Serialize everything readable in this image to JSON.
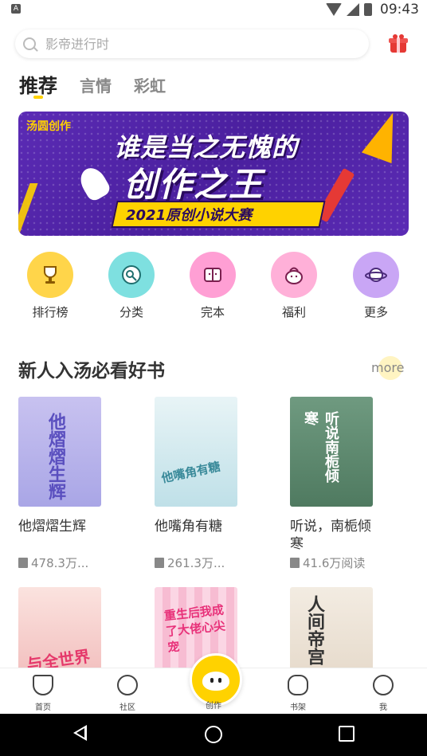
{
  "status_bar": {
    "time": "09:43",
    "app_icon_letter": "A"
  },
  "search": {
    "placeholder": "影帝进行时"
  },
  "tabs": [
    {
      "label": "推荐",
      "active": true
    },
    {
      "label": "言情",
      "active": false
    },
    {
      "label": "彩虹",
      "active": false
    }
  ],
  "banner": {
    "logo": "汤圆创作",
    "title_line1": "谁是当之无愧的",
    "title_line2": "创作之王",
    "subtitle": "2021原创小说大赛"
  },
  "categories": [
    {
      "label": "排行榜",
      "icon": "trophy-icon",
      "color": "#ffd54a"
    },
    {
      "label": "分类",
      "icon": "category-icon",
      "color": "#7ee0e0"
    },
    {
      "label": "完本",
      "icon": "book-open-icon",
      "color": "#ff9fd4"
    },
    {
      "label": "福利",
      "icon": "gift-bag-icon",
      "color": "#ffb0d8"
    },
    {
      "label": "更多",
      "icon": "planet-icon",
      "color": "#c9a6f5"
    }
  ],
  "section": {
    "title": "新人入汤必看好书",
    "more": "more"
  },
  "books": [
    {
      "title": "他熠熠生辉",
      "reads": "478.3万...",
      "cover_text": "他熠熠生辉",
      "cover_bg": "#b8b4e8"
    },
    {
      "title": "他嘴角有糖",
      "reads": "261.3万...",
      "cover_text": "他嘴角有糖",
      "cover_bg": "#cfe8ef"
    },
    {
      "title": "听说，南栀倾寒",
      "reads": "41.6万阅读",
      "cover_text": "听说南栀倾寒",
      "cover_bg": "#5f8b70"
    },
    {
      "title": "",
      "reads": "",
      "cover_text": "与全世界",
      "cover_bg": "#f6d0cf"
    },
    {
      "title": "",
      "reads": "",
      "cover_text": "重生后我成了大佬心尖宠",
      "cover_bg": "#f9c9dd"
    },
    {
      "title": "",
      "reads": "",
      "cover_text": "人间帝宫",
      "cover_bg": "#efe6d9"
    }
  ],
  "bottom_nav": [
    {
      "label": "首页",
      "icon": "home-icon"
    },
    {
      "label": "社区",
      "icon": "community-icon"
    },
    {
      "label": "创作",
      "icon": "create-icon"
    },
    {
      "label": "书架",
      "icon": "bookshelf-star-icon"
    },
    {
      "label": "我",
      "icon": "profile-icon"
    }
  ],
  "colors": {
    "accent": "#ffd200",
    "banner_bg": "#5b2bb5"
  }
}
